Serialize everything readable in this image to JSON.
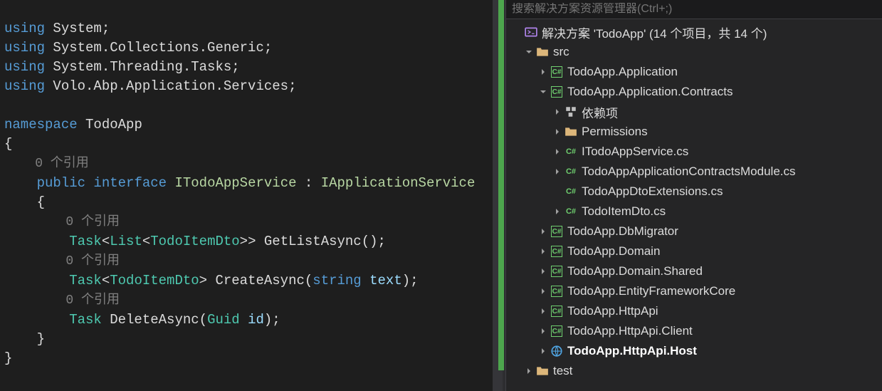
{
  "code": {
    "using1_kw": "using",
    "using1_ns": " System;",
    "using2_kw": "using",
    "using2_ns": " System.Collections.Generic;",
    "using3_kw": "using",
    "using3_ns": " System.Threading.Tasks;",
    "using4_kw": "using",
    "using4_ns": " Volo.Abp.Application.Services;",
    "blank": "",
    "ns_kw": "namespace",
    "ns_name": " TodoApp",
    "brace_open": "{",
    "ref0": "    0 个引用",
    "decl_public": "    public",
    "decl_interface": " interface",
    "decl_name": " ITodoAppService",
    "decl_colon": " : ",
    "decl_base": "IApplicationService",
    "brace_open2": "    {",
    "ref1": "        0 个引用",
    "m1_type": "        Task",
    "m1_lt1": "<",
    "m1_list": "List",
    "m1_lt2": "<",
    "m1_dto": "TodoItemDto",
    "m1_gt2": ">>",
    "m1_name": " GetListAsync",
    "m1_parens": "();",
    "ref2": "        0 个引用",
    "m2_type": "        Task",
    "m2_lt": "<",
    "m2_dto": "TodoItemDto",
    "m2_gt": ">",
    "m2_name": " CreateAsync",
    "m2_lp": "(",
    "m2_ptype": "string",
    "m2_pname": " text",
    "m2_rp": ");",
    "ref3": "        0 个引用",
    "m3_type": "        Task",
    "m3_name": " DeleteAsync",
    "m3_lp": "(",
    "m3_ptype": "Guid",
    "m3_pname": " id",
    "m3_rp": ");",
    "brace_close2": "    }",
    "brace_close": "}"
  },
  "explorer": {
    "search_placeholder": "搜索解决方案资源管理器(Ctrl+;)",
    "solution": "解决方案 'TodoApp' (14 个项目，共 14 个)",
    "src": "src",
    "proj_app": "TodoApp.Application",
    "proj_contracts": "TodoApp.Application.Contracts",
    "deps": "依赖项",
    "perms": "Permissions",
    "file_itodo": "ITodoAppService.cs",
    "file_contractsmod": "TodoAppApplicationContractsModule.cs",
    "file_dtoext": "TodoAppDtoExtensions.cs",
    "file_itemdto": "TodoItemDto.cs",
    "proj_dbmig": "TodoApp.DbMigrator",
    "proj_domain": "TodoApp.Domain",
    "proj_domainshared": "TodoApp.Domain.Shared",
    "proj_efcore": "TodoApp.EntityFrameworkCore",
    "proj_httpapi": "TodoApp.HttpApi",
    "proj_httpapiclient": "TodoApp.HttpApi.Client",
    "proj_httpapihost": "TodoApp.HttpApi.Host",
    "test": "test"
  }
}
